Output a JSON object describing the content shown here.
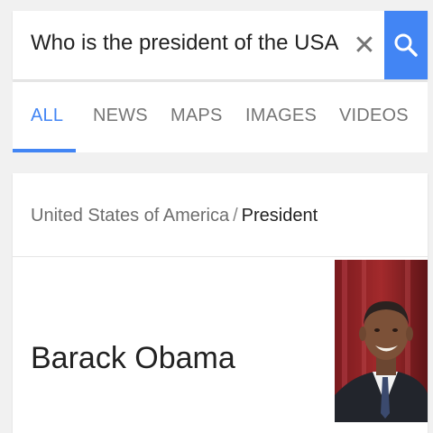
{
  "search": {
    "query": "Who is the president of the USA",
    "clear_icon": "close-icon",
    "search_icon": "search-icon",
    "accent": "#4285f4"
  },
  "tabs": [
    {
      "label": "ALL",
      "active": true
    },
    {
      "label": "NEWS",
      "active": false
    },
    {
      "label": "MAPS",
      "active": false
    },
    {
      "label": "IMAGES",
      "active": false
    },
    {
      "label": "VIDEOS",
      "active": false
    }
  ],
  "knowledge_card": {
    "breadcrumb_parent": "United States of America",
    "breadcrumb_separator": "/",
    "breadcrumb_current": "President",
    "answer": "Barack Obama",
    "image": "portrait-photo"
  }
}
